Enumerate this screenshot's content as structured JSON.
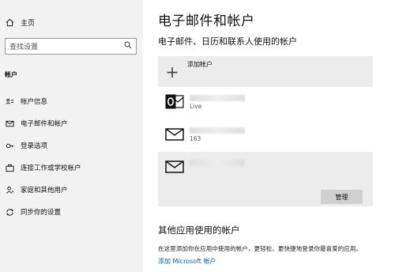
{
  "sidebar": {
    "home_label": "主页",
    "search_placeholder": "查找设置",
    "section_label": "帐户",
    "items": [
      {
        "label": "帐户信息",
        "icon": "person-card-icon"
      },
      {
        "label": "电子邮件和帐户",
        "icon": "mail-icon"
      },
      {
        "label": "登录选项",
        "icon": "key-icon"
      },
      {
        "label": "连接工作或学校帐户",
        "icon": "briefcase-icon"
      },
      {
        "label": "家庭和其他用户",
        "icon": "people-icon"
      },
      {
        "label": "同步你的设置",
        "icon": "sync-icon"
      }
    ]
  },
  "main": {
    "title": "电子邮件和帐户",
    "subtitle": "电子邮件、日历和联系人使用的帐户",
    "add_account_label": "添加帐户",
    "accounts": [
      {
        "type": "outlook",
        "sub": "Live"
      },
      {
        "type": "mail",
        "sub": "163"
      },
      {
        "type": "mail",
        "sub": ""
      }
    ],
    "manage_label": "管理",
    "other_title": "其他应用使用的帐户",
    "other_desc": "在这里添加你在应用中使用的帐户，更轻松、更快捷地登录你最喜爱的应用。",
    "add_ms_label": "添加 Microsoft 帐户"
  },
  "colors": {
    "sidebar_bg": "#f2f2f2",
    "row_bg": "#ececec",
    "button_bg": "#cfcfcf",
    "link": "#0063b1",
    "outlook_blue": "#0a0a0a"
  }
}
